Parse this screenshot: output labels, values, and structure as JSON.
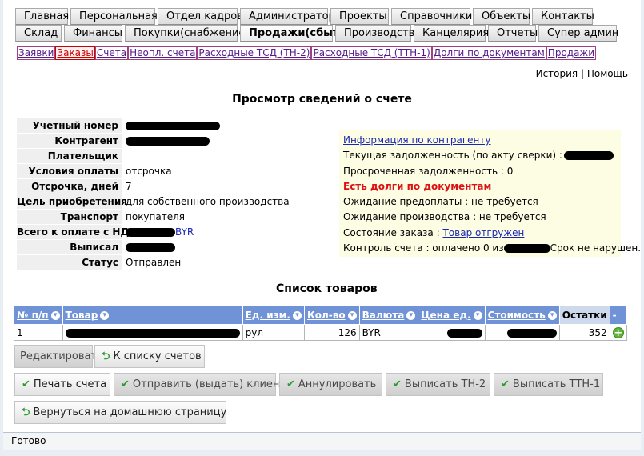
{
  "tabs_row1": [
    "Главная",
    "Персональная",
    "Отдел кадров",
    "Администратор",
    "Проекты",
    "Справочники",
    "Объекты",
    "Контакты"
  ],
  "tabs_row2": [
    "Склад",
    "Финансы",
    "Покупки(снабжение)",
    "Продажи(сбыт)",
    "Производство",
    "Канцелярия",
    "Отчеты",
    "Супер админ"
  ],
  "active_tab": "Продажи(сбыт)",
  "subnav": [
    "Заявки",
    "Заказы",
    "Счета",
    "Неопл. счета",
    "Расходные ТСД (ТН-2)",
    "Расходные ТСД (ТТН-1)",
    "Долги по документам",
    "Продажи"
  ],
  "topright": {
    "history": "История",
    "sep": "|",
    "help": "Помощь"
  },
  "page_title": "Просмотр сведений о счете",
  "fields": {
    "account_number": {
      "label": "Учетный номер",
      "value": ""
    },
    "contractor": {
      "label": "Контрагент",
      "value": ""
    },
    "payer": {
      "label": "Плательщик",
      "value": ""
    },
    "payment_terms": {
      "label": "Условия оплаты",
      "value": "отсрочка"
    },
    "delay_days": {
      "label": "Отсрочка, дней",
      "value": "7"
    },
    "purpose": {
      "label": "Цель приобретения",
      "value": "для собственного производства"
    },
    "transport": {
      "label": "Транспорт",
      "value": "покупателя"
    },
    "total_vat": {
      "label": "Всего к оплате с НДС",
      "currency": "BYR"
    },
    "issued_by": {
      "label": "Выписал",
      "value": ""
    },
    "status": {
      "label": "Статус",
      "value": "Отправлен"
    }
  },
  "info": {
    "contractor_link": "Информация по контрагенту",
    "current_debt": "Текущая задолженность (по акту сверки) :",
    "overdue_debt": "Просроченная задолженность : 0",
    "doc_debts": "Есть долги по документам",
    "prepay_wait": "Ожидание предоплаты : не требуется",
    "production_wait": "Ожидание производства : не требуется",
    "order_state_label": "Состояние заказа :",
    "order_state_value": "Товар отгружен",
    "control_prefix": "Контроль счета : оплачено 0 из",
    "control_suffix": "Срок не нарушен."
  },
  "list_title": "Список товаров",
  "table": {
    "headers": [
      "№ п/п",
      "Товар",
      "Ед. изм.",
      "Кол-во",
      "Валюта",
      "Цена ед.",
      "Стоимость",
      "Остатки",
      "-"
    ],
    "rows": [
      {
        "n": "1",
        "product": "",
        "unit": "рул",
        "qty": "126",
        "currency": "BYR",
        "price": "",
        "cost": "",
        "stock": "352"
      }
    ]
  },
  "buttons": {
    "edit": "Редактировать",
    "back_to_list": "К списку счетов",
    "print": "Печать счета",
    "send_client": "Отправить (выдать) клиенту",
    "cancel": "Аннулировать",
    "issue_tn2": "Выписать ТН-2",
    "issue_ttn1": "Выписать ТТН-1",
    "home": "Вернуться на домашнюю страницу"
  },
  "statusbar": "Готово"
}
